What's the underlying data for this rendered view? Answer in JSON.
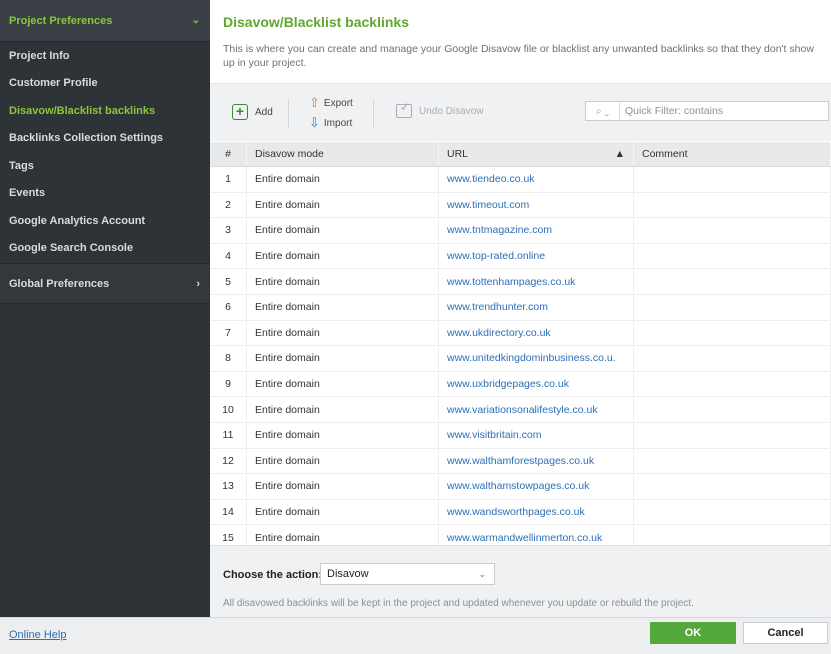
{
  "sidebar": {
    "header": "Project Preferences",
    "items": [
      {
        "label": "Project Info",
        "active": false
      },
      {
        "label": "Customer Profile",
        "active": false
      },
      {
        "label": "Disavow/Blacklist backlinks",
        "active": true
      },
      {
        "label": "Backlinks Collection Settings",
        "active": false
      },
      {
        "label": "Tags",
        "active": false
      },
      {
        "label": "Events",
        "active": false
      },
      {
        "label": "Google Analytics Account",
        "active": false
      },
      {
        "label": "Google Search Console",
        "active": false
      }
    ],
    "global": "Global Preferences"
  },
  "main": {
    "title": "Disavow/Blacklist backlinks",
    "description": "This is where you can create and manage your Google Disavow file or blacklist any unwanted backlinks so that they don't show up in your project."
  },
  "toolbar": {
    "add_label": "Add",
    "export_label": "Export",
    "import_label": "Import",
    "undo_label": "Undo Disavow",
    "search_placeholder": "Quick Filter: contains"
  },
  "table": {
    "columns": [
      "#",
      "Disavow mode",
      "URL",
      "Comment"
    ],
    "rows": [
      {
        "num": "1",
        "mode": "Entire domain",
        "url": "www.tiendeo.co.uk",
        "comment": ""
      },
      {
        "num": "2",
        "mode": "Entire domain",
        "url": "www.timeout.com",
        "comment": ""
      },
      {
        "num": "3",
        "mode": "Entire domain",
        "url": "www.tntmagazine.com",
        "comment": ""
      },
      {
        "num": "4",
        "mode": "Entire domain",
        "url": "www.top-rated.online",
        "comment": ""
      },
      {
        "num": "5",
        "mode": "Entire domain",
        "url": "www.tottenhampages.co.uk",
        "comment": ""
      },
      {
        "num": "6",
        "mode": "Entire domain",
        "url": "www.trendhunter.com",
        "comment": ""
      },
      {
        "num": "7",
        "mode": "Entire domain",
        "url": "www.ukdirectory.co.uk",
        "comment": ""
      },
      {
        "num": "8",
        "mode": "Entire domain",
        "url": "www.unitedkingdominbusiness.co.u.",
        "comment": ""
      },
      {
        "num": "9",
        "mode": "Entire domain",
        "url": "www.uxbridgepages.co.uk",
        "comment": ""
      },
      {
        "num": "10",
        "mode": "Entire domain",
        "url": "www.variationsonalifestyle.co.uk",
        "comment": ""
      },
      {
        "num": "11",
        "mode": "Entire domain",
        "url": "www.visitbritain.com",
        "comment": ""
      },
      {
        "num": "12",
        "mode": "Entire domain",
        "url": "www.walthamforestpages.co.uk",
        "comment": ""
      },
      {
        "num": "13",
        "mode": "Entire domain",
        "url": "www.walthamstowpages.co.uk",
        "comment": ""
      },
      {
        "num": "14",
        "mode": "Entire domain",
        "url": "www.wandsworthpages.co.uk",
        "comment": ""
      },
      {
        "num": "15",
        "mode": "Entire domain",
        "url": "www.warmandwellinmerton.co.uk",
        "comment": ""
      }
    ]
  },
  "action": {
    "label": "Choose the action:",
    "selected": "Disavow",
    "note": "All disavowed backlinks will be kept in the project and updated whenever you update or rebuild the project."
  },
  "footer": {
    "help": "Online Help",
    "ok": "OK",
    "cancel": "Cancel"
  },
  "colors": {
    "accent_green": "#8cc63f",
    "title_green": "#5fa82e",
    "link_blue": "#2d6fb8",
    "sidebar_bg": "#2e3338",
    "ok_button": "#55a83a"
  }
}
